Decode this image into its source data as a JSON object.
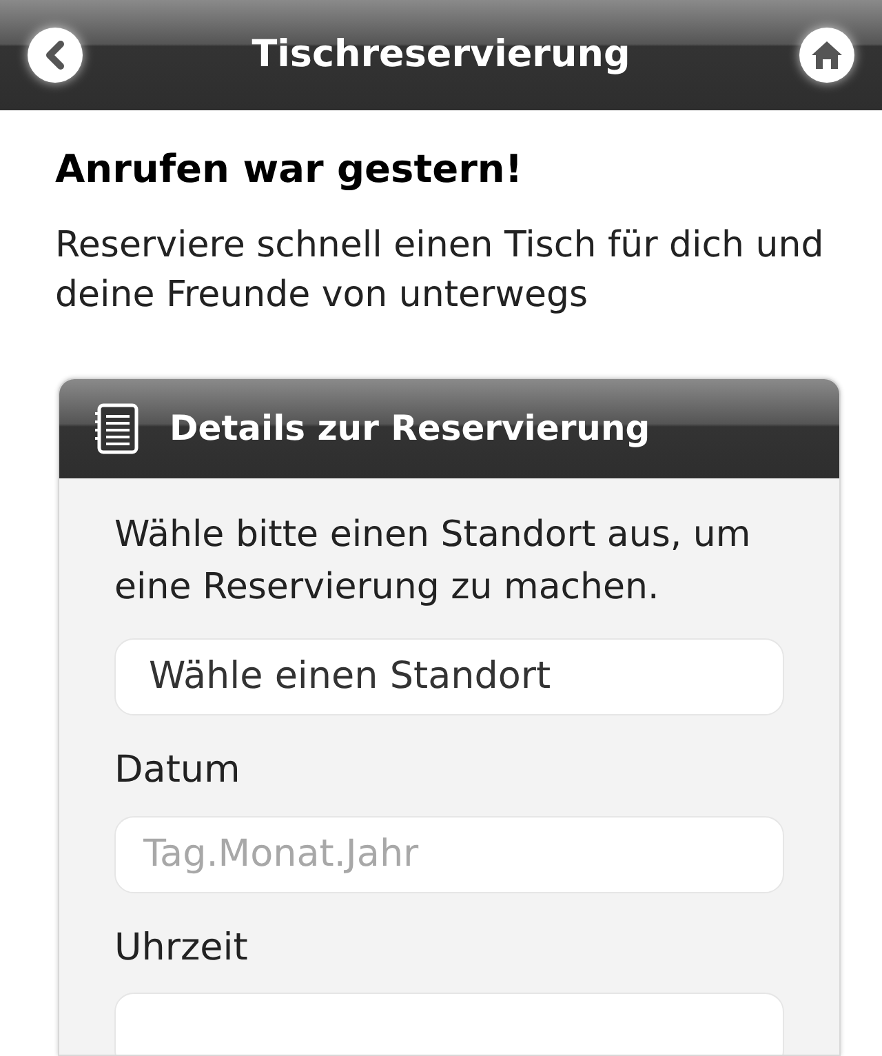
{
  "header": {
    "title": "Tischreservierung"
  },
  "intro": {
    "heading": "Anrufen war gestern!",
    "text": "Reserviere schnell einen Tisch für dich und deine Freunde von unterwegs"
  },
  "card": {
    "title": "Details zur Reservierung",
    "instruction": "Wähle bitte einen Standort aus, um eine Reservierung zu machen.",
    "fields": [
      {
        "kind": "select",
        "value": "Wähle einen Standort"
      },
      {
        "kind": "label",
        "text": "Datum"
      },
      {
        "kind": "input",
        "placeholder": "Tag.Monat.Jahr"
      },
      {
        "kind": "label",
        "text": "Uhrzeit"
      },
      {
        "kind": "input"
      }
    ]
  }
}
